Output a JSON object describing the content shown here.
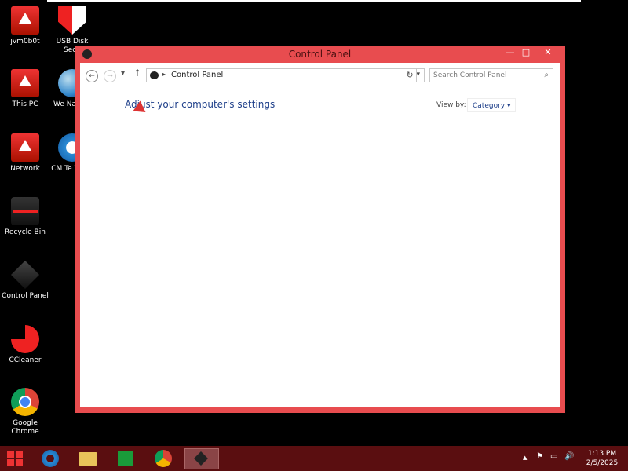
{
  "desktop": {
    "icons": [
      {
        "label": "jvm0b0t",
        "icon": "red-folder-icon"
      },
      {
        "label": "This PC",
        "icon": "this-pc-icon"
      },
      {
        "label": "Network",
        "icon": "network-icon"
      },
      {
        "label": "Recycle Bin",
        "icon": "recycle-bin-icon"
      },
      {
        "label": "Control Panel",
        "icon": "control-panel-icon"
      },
      {
        "label": "CCleaner",
        "icon": "ccleaner-icon"
      },
      {
        "label": "Google Chrome",
        "icon": "chrome-icon"
      },
      {
        "label": "USB Disk Secu",
        "icon": "usb-disk-security-icon"
      },
      {
        "label": "We Naviga",
        "icon": "web-navigator-icon"
      },
      {
        "label": "CM Te Webs",
        "icon": "internet-explorer-icon"
      }
    ]
  },
  "window": {
    "title": "Control Panel",
    "buttons": {
      "minimize": "—",
      "maximize": "□",
      "close": "✕"
    },
    "nav": {
      "back": "←",
      "forward": "→",
      "recent": "▾",
      "up": "↑",
      "breadcrumb_sep": "▸",
      "breadcrumb": "Control Panel",
      "address_dropdown": "▾",
      "refresh": "↻",
      "search_placeholder": "Search Control Panel",
      "search_icon": "⌕"
    },
    "heading": "Adjust your computer's settings",
    "view_by_label": "View by:",
    "view_by_value": "Category ▾"
  },
  "taskbar": {
    "start": "start-icon",
    "pinned": [
      "internet-explorer-icon",
      "file-explorer-icon",
      "store-icon",
      "chrome-icon",
      "control-panel-icon"
    ],
    "tray": {
      "up_arrow": "▲",
      "flag": "⚑",
      "network": "▭",
      "volume": "🔊"
    },
    "time": "1:13 PM",
    "date": "2/5/2025"
  },
  "colors": {
    "window_accent": "#e84c4f",
    "taskbar": "#5a0e10",
    "link_blue": "#1e3f8a"
  }
}
